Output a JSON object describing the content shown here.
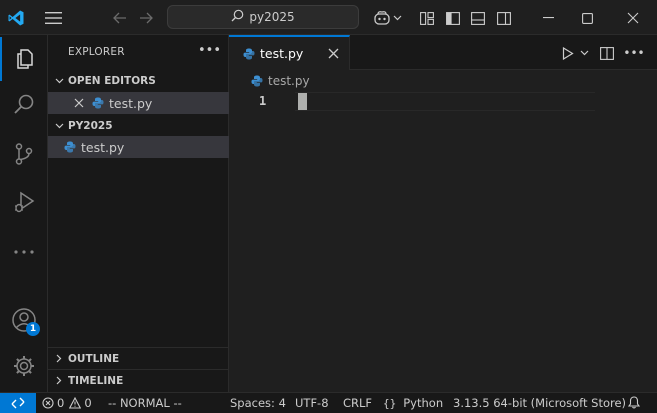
{
  "titlebar": {
    "search_text": "py2025",
    "icons": [
      "vscode-logo-icon",
      "menu-icon",
      "back-arrow-icon",
      "forward-arrow-icon",
      "search-icon",
      "copilot-icon",
      "chevron-down-icon",
      "layout-customize-icon",
      "toggle-sidebar-icon",
      "toggle-panel-icon",
      "toggle-secondary-sidebar-icon",
      "minimize-icon",
      "maximize-icon",
      "close-icon"
    ]
  },
  "activitybar": {
    "items": [
      "explorer-icon",
      "search-icon",
      "source-control-icon",
      "run-debug-icon",
      "more-icon"
    ],
    "account_badge": "1",
    "bottom": [
      "account-icon",
      "settings-gear-icon"
    ]
  },
  "sidebar": {
    "title": "EXPLORER",
    "open_editors_label": "OPEN EDITORS",
    "open_editor_file": "test.py",
    "folder_label": "PY2025",
    "folder_file": "test.py",
    "outline_label": "OUTLINE",
    "timeline_label": "TIMELINE"
  },
  "editor": {
    "tab_label": "test.py",
    "breadcrumb_file": "test.py",
    "line_number": "1"
  },
  "statusbar": {
    "errors": "0",
    "warnings": "0",
    "mode": "-- NORMAL --",
    "spaces": "Spaces: 4",
    "encoding": "UTF-8",
    "eol": "CRLF",
    "language": "Python",
    "interpreter": "3.13.5 64-bit (Microsoft Store)"
  },
  "colors": {
    "accent": "#0078d4",
    "python_blue": "#3d8fd1",
    "python_yellow": "#e8c547"
  }
}
